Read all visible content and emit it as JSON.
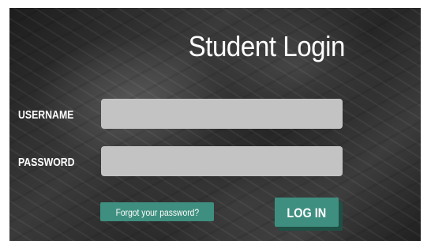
{
  "login": {
    "title": "Student Login",
    "username_label": "USERNAME",
    "username_value": "",
    "password_label": "PASSWORD",
    "password_value": "",
    "forgot_password_label": "Forgot your password?",
    "login_button_label": "LOG IN"
  },
  "colors": {
    "accent": "#3e8f7f",
    "input_background": "#c3c3c3",
    "text": "#ffffff"
  }
}
